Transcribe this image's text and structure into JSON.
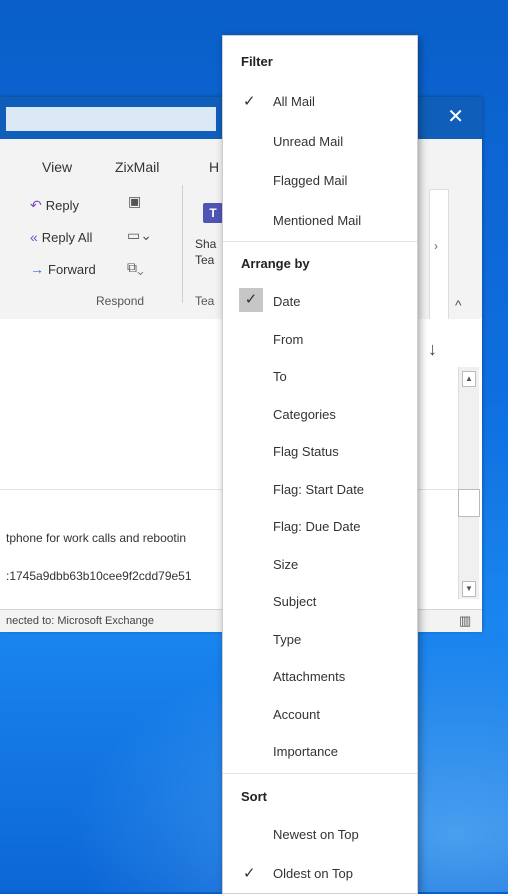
{
  "window": {
    "close_glyph": "✕",
    "tabs": [
      "View",
      "ZixMail",
      "H"
    ],
    "ribbon": {
      "reply": "Reply",
      "reply_all": "Reply All",
      "forward": "Forward",
      "respond_group": "Respond",
      "teams_short": "T",
      "teams_label_1": "Sha",
      "teams_label_2": "Tea",
      "teams_group_partial": "Tea",
      "more_glyph": "›",
      "collapse_glyph": "^"
    },
    "content": {
      "sort_arrow": "↓",
      "preview_line_1": "tphone for work calls and rebootin",
      "preview_line_2": ":1745a9dbb63b10cee9f2cdd79e51"
    },
    "status": {
      "text": "nected to: Microsoft Exchange",
      "book_glyph": "▥"
    }
  },
  "menu": {
    "filter": {
      "header": "Filter",
      "items": [
        {
          "label": "All Mail",
          "checked": true
        },
        {
          "label": "Unread Mail",
          "checked": false
        },
        {
          "label": "Flagged Mail",
          "checked": false
        },
        {
          "label": "Mentioned Mail",
          "checked": false
        }
      ]
    },
    "arrange": {
      "header": "Arrange by",
      "items": [
        {
          "label": "Date",
          "checked": true
        },
        {
          "label": "From",
          "checked": false
        },
        {
          "label": "To",
          "checked": false
        },
        {
          "label": "Categories",
          "checked": false
        },
        {
          "label": "Flag Status",
          "checked": false
        },
        {
          "label": "Flag: Start Date",
          "checked": false
        },
        {
          "label": "Flag: Due Date",
          "checked": false
        },
        {
          "label": "Size",
          "checked": false
        },
        {
          "label": "Subject",
          "checked": false
        },
        {
          "label": "Type",
          "checked": false
        },
        {
          "label": "Attachments",
          "checked": false
        },
        {
          "label": "Account",
          "checked": false
        },
        {
          "label": "Importance",
          "checked": false
        }
      ]
    },
    "sort": {
      "header": "Sort",
      "items": [
        {
          "label": "Newest on Top",
          "checked": false
        },
        {
          "label": "Oldest on Top",
          "checked": true
        }
      ]
    },
    "check_glyph": "✓"
  }
}
